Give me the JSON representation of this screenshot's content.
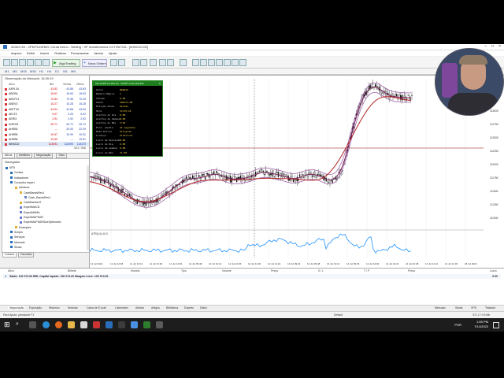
{
  "window": {
    "title": "30461745 - XPMT5-DEMO: Conta Demo - Netting - XP Investimentos CCTVM S/A - [WING22,M2]"
  },
  "menu": [
    "Arquivo",
    "Exibir",
    "Inserir",
    "Gráficos",
    "Ferramentas",
    "Janela",
    "Ajuda"
  ],
  "toolbar": {
    "algotrading": "AlgoTrading",
    "new_order": "Nova Ordem"
  },
  "timeframes": [
    "M1",
    "M5",
    "M15",
    "M30",
    "H1",
    "H4",
    "D1",
    "W1",
    "MN"
  ],
  "market_watch": {
    "title": "Observação do Mercado: 15:39:19",
    "headers": [
      "Ativo",
      "Bid",
      "Venda",
      "Último"
    ],
    "rows": [
      {
        "symbol": "AAPL34",
        "bid": "43.82",
        "ask": "43.88",
        "last": "43.83"
      },
      {
        "symbol": "ABCB4",
        "bid": "18.61",
        "ask": "18.63",
        "last": "18.63"
      },
      {
        "symbol": "ABCP11",
        "bid": "70.84",
        "ask": "70.98",
        "last": "70.93"
      },
      {
        "symbol": "ABEV3",
        "bid": "15.27",
        "ask": "15.28",
        "last": "15.28"
      },
      {
        "symbol": "ABTT34",
        "bid": "43.54",
        "ask": "43.68",
        "last": "43.64"
      },
      {
        "symbol": "AELT3",
        "bid": "9.07",
        "ask": "9.25",
        "last": "9.22"
      },
      {
        "symbol": "AERI3",
        "bid": "2.91",
        "ask": "2.92",
        "last": "2.92"
      },
      {
        "symbol": "AGRO3",
        "bid": "25.71",
        "ask": "25.72",
        "last": "25.72"
      },
      {
        "symbol": "AHEB3",
        "bid": "---",
        "ask": "20.00",
        "last": "22.09"
      },
      {
        "symbol": "AHEB5",
        "bid": "10.57",
        "ask": "10.99",
        "last": "10.51"
      },
      {
        "symbol": "AHEB6",
        "bid": "10.50",
        "ask": "---",
        "last": "10.51"
      },
      {
        "symbol": "WING22",
        "bid": "113491",
        "ask": "113495",
        "last": "113470"
      }
    ],
    "footer": "4/11 / 546"
  },
  "mw_tabs": [
    "Ativos",
    "Detalhes",
    "Negociação",
    "Ticks"
  ],
  "navigator": {
    "title": "Navegador",
    "items": [
      {
        "label": "MT5",
        "level": 0,
        "color": "#2a6ebb"
      },
      {
        "label": "Contas",
        "level": 1,
        "color": "#2a6ebb"
      },
      {
        "label": "Indicadores",
        "level": 1,
        "color": "#2a6ebb"
      },
      {
        "label": "Consultor expert",
        "level": 1,
        "color": "#2a6ebb"
      },
      {
        "label": "Advisors",
        "level": 2,
        "color": "#e0b030"
      },
      {
        "label": "CashBandsRev1",
        "level": 3,
        "color": "#e0b030"
      },
      {
        "label": "Cash_BandsRev1",
        "level": 4,
        "color": "#6a7fd0"
      },
      {
        "label": "CashBandsV2",
        "level": 3,
        "color": "#e0b030"
      },
      {
        "label": "ExpertMACD",
        "level": 3,
        "color": "#6a7fd0"
      },
      {
        "label": "ExpertMAMA",
        "level": 3,
        "color": "#6a7fd0"
      },
      {
        "label": "ExpertMAPSAR",
        "level": 3,
        "color": "#6a7fd0"
      },
      {
        "label": "ExpertMAPSARSizeOptimized",
        "level": 3,
        "color": "#6a7fd0"
      },
      {
        "label": "Examples",
        "level": 2,
        "color": "#e0b030"
      },
      {
        "label": "Scripts",
        "level": 1,
        "color": "#2a6ebb"
      },
      {
        "label": "Serviços",
        "level": 1,
        "color": "#2a6ebb"
      },
      {
        "label": "Mercado",
        "level": 1,
        "color": "#2a6ebb"
      },
      {
        "label": "Sinais",
        "level": 1,
        "color": "#2a6ebb"
      }
    ],
    "tabs": [
      "Comum",
      "Favoritos"
    ]
  },
  "robot_panel": {
    "title": "MR ROBÔ DA BOLSA - ROBÔ CASH BANDS",
    "rows": [
      {
        "k": "Ativo",
        "v": "WING22"
      },
      {
        "k": "Número Mágico",
        "v": "1"
      },
      {
        "k": "Volume",
        "v": "0.00"
      },
      {
        "k": "Saldo",
        "v": "100174.00"
      },
      {
        "k": "Posição Atual",
        "v": "Zerado"
      },
      {
        "k": "Hora",
        "v": "13:05:16"
      },
      {
        "k": "Acertos do Dia",
        "v": "0.00"
      },
      {
        "k": "Acertos da Semana",
        "v": "0.00"
      },
      {
        "k": "Acertos do Mês",
        "v": "7/10"
      },
      {
        "k": "Prot. Candle",
        "v": "41 segundos"
      },
      {
        "k": "Meta Diária",
        "v": "Atingida"
      },
      {
        "k": "Licença",
        "v": "Vitalícia"
      },
      {
        "k": "Lucro de Operação",
        "v": "0.00"
      },
      {
        "k": "Lucro do Dia",
        "v": "0.00"
      },
      {
        "k": "Lucro da Semana",
        "v": "0.00"
      },
      {
        "k": "Lucro do Mês",
        "v": "71.00"
      }
    ]
  },
  "chart": {
    "price_labels": [
      "113495",
      "113260",
      "113000",
      "112750",
      "112500",
      "112250",
      "112000",
      "111750",
      "111500",
      "111250",
      "111000"
    ],
    "time_labels": [
      "11 Jul 2022",
      "11 Jul 12:48",
      "11 Jul 13:12",
      "11 Jul 13:36",
      "11 Jul 14:00",
      "12 Jul 09:48",
      "12 Jul 10:12",
      "12 Jul 10:36",
      "12 Jul 11:00",
      "12 Jul 11:24",
      "13 Jul 09:24",
      "13 Jul 09:48",
      "13 Jul 10:12",
      "14 Jul 09:36",
      "14 Jul 10:00",
      "14 Jul 10:24",
      "14 Jul 10:48",
      "14 Jul 11:12",
      "14 Jul 11:36",
      "18 Jul 2022"
    ],
    "indicator_label": "ATR(14) 42.0",
    "colors": {
      "bull": "#111111",
      "bear": "#111111",
      "ma_fast": "#7a1f5a",
      "ma_slow": "#b22222",
      "band": "#9e63a8",
      "atr": "#1e90ff",
      "hline": "#8b0000"
    }
  },
  "toolbox": {
    "headers": [
      "Ativo",
      "Bilhete",
      "Horário",
      "Tipo",
      "Volume",
      "Preço",
      "S / L",
      "T / P",
      "Preço",
      "Lucro"
    ],
    "balance_line": "Saldo: 100 074.00 BRL  Capital líquido: 100 074.00  Margem Livre: 100 074.00",
    "balance_value": "0.00",
    "tabs": [
      "Negociação",
      "Exposição",
      "Histórico",
      "Notícias",
      "Caixa de E-mail",
      "Calendário",
      "Alertas",
      "Artigos",
      "Biblioteca",
      "Experts",
      "Diário"
    ],
    "right_items": [
      "Mercado",
      "Sinais",
      "VPS",
      "Testador"
    ]
  },
  "statusbar": {
    "left": "Para Ajuda, pressione F1",
    "middle": "Default",
    "right": "371.2 / 0.5 Mb"
  },
  "taskbar": {
    "time": "1:55 PM",
    "date": "7/14/2022",
    "lang": "POR"
  }
}
